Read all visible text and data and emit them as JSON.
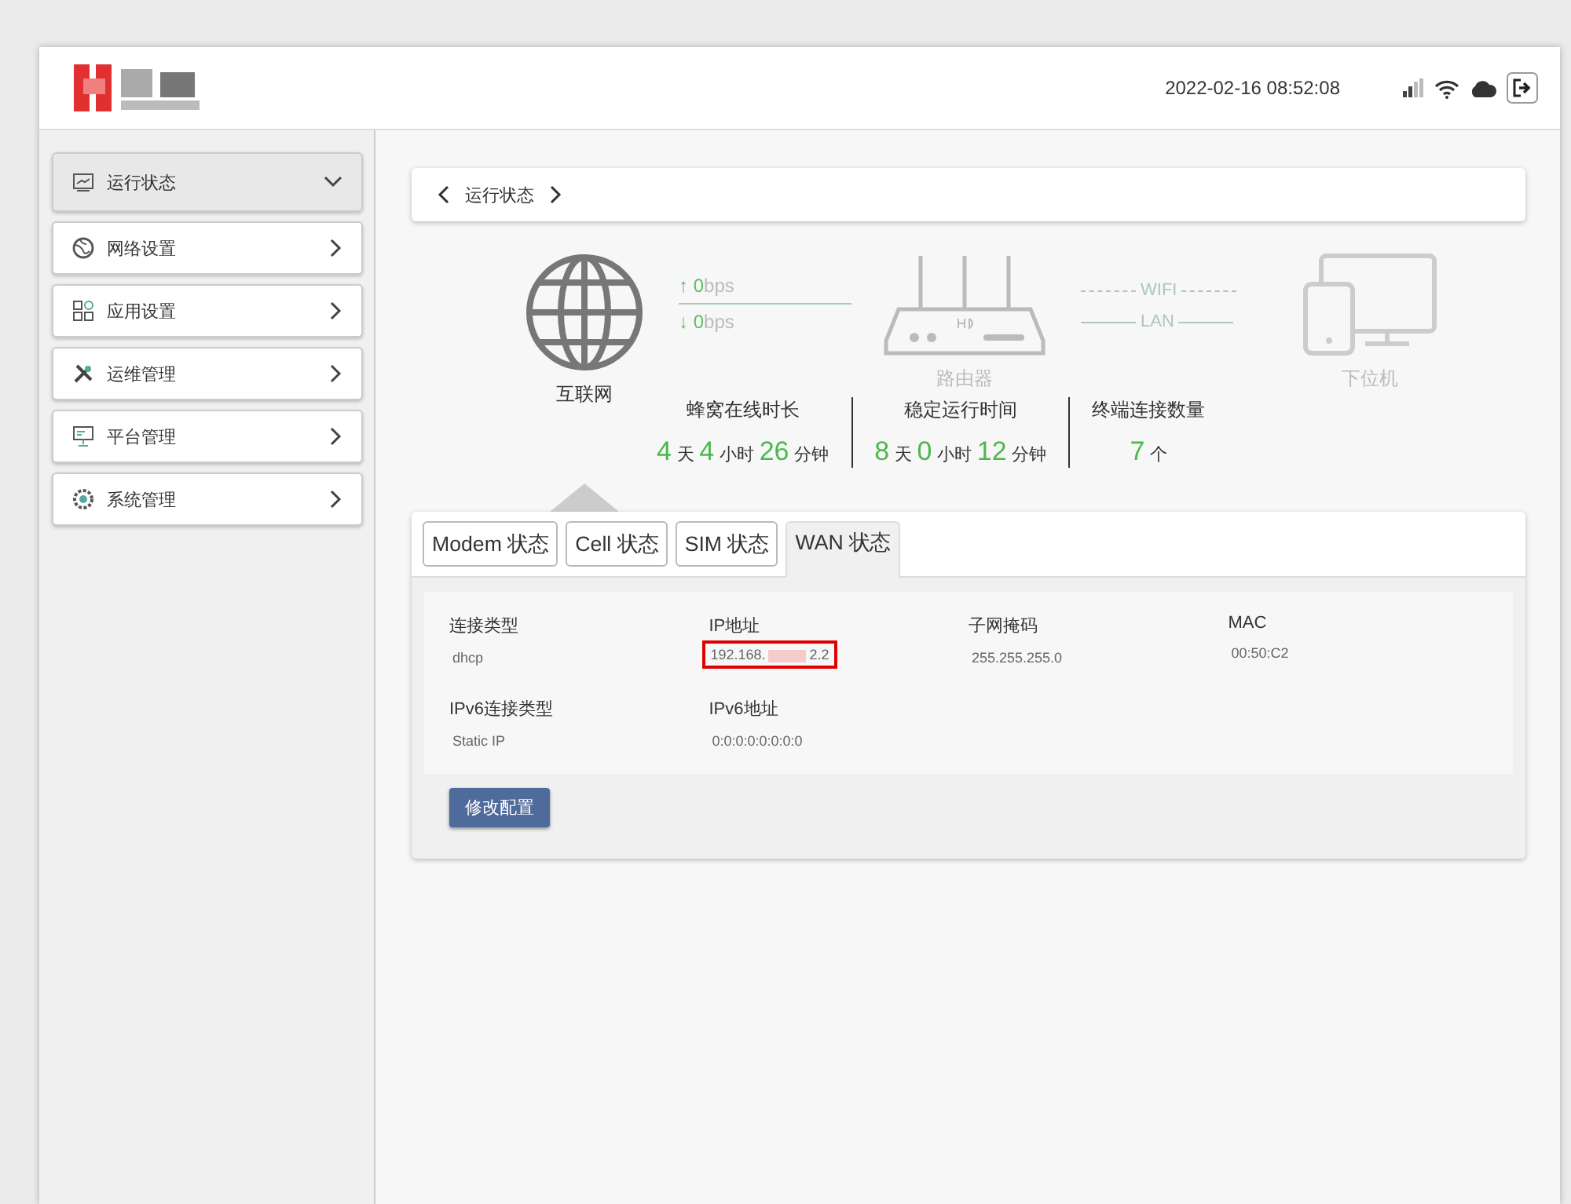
{
  "header": {
    "datetime": "2022-02-16 08:52:08"
  },
  "sidebar": {
    "items": [
      {
        "label": "运行状态",
        "expanded": true
      },
      {
        "label": "网络设置",
        "expanded": false
      },
      {
        "label": "应用设置",
        "expanded": false
      },
      {
        "label": "运维管理",
        "expanded": false
      },
      {
        "label": "平台管理",
        "expanded": false
      },
      {
        "label": "系统管理",
        "expanded": false
      }
    ]
  },
  "breadcrumb": {
    "title": "运行状态"
  },
  "topology": {
    "internet": "互联网",
    "up_arrow": "↑",
    "down_arrow": "↓",
    "up_value": "0",
    "up_unit": "bps",
    "down_value": "0",
    "down_unit": "bps",
    "router": "路由器",
    "wifi": "WIFI",
    "lan": "LAN",
    "device": "下位机"
  },
  "stats": [
    {
      "label": "蜂窝在线时长",
      "parts": [
        {
          "kind": "num",
          "text": "4"
        },
        {
          "kind": "unit",
          "text": "天"
        },
        {
          "kind": "num",
          "text": "4"
        },
        {
          "kind": "unit",
          "text": "小时"
        },
        {
          "kind": "num",
          "text": "26"
        },
        {
          "kind": "unit",
          "text": "分钟"
        }
      ]
    },
    {
      "label": "稳定运行时间",
      "parts": [
        {
          "kind": "num",
          "text": "8"
        },
        {
          "kind": "unit",
          "text": "天"
        },
        {
          "kind": "num",
          "text": "0"
        },
        {
          "kind": "unit",
          "text": "小时"
        },
        {
          "kind": "num",
          "text": "12"
        },
        {
          "kind": "unit",
          "text": "分钟"
        }
      ]
    },
    {
      "label": "终端连接数量",
      "parts": [
        {
          "kind": "num",
          "text": "7"
        },
        {
          "kind": "unit",
          "text": "个"
        }
      ]
    }
  ],
  "tabs": [
    {
      "label": "Modem 状态",
      "selected": false
    },
    {
      "label": "Cell 状态",
      "selected": false
    },
    {
      "label": "SIM 状态",
      "selected": false
    },
    {
      "label": "WAN 状态",
      "selected": true
    }
  ],
  "fields": [
    {
      "label": "连接类型",
      "value": "dhcp",
      "highlighted": false
    },
    {
      "label": "IP地址",
      "value": "192.168.",
      "value_tail": "2.2",
      "highlighted": true
    },
    {
      "label": "子网掩码",
      "value": "255.255.255.0",
      "highlighted": false
    },
    {
      "label": "MAC",
      "value": "00:50:C2",
      "highlighted": false
    },
    {
      "label": "IPv6连接类型",
      "value": "Static IP",
      "highlighted": false
    },
    {
      "label": "IPv6地址",
      "value": "0:0:0:0:0:0:0:0",
      "highlighted": false
    }
  ],
  "edit_button": "修改配置"
}
